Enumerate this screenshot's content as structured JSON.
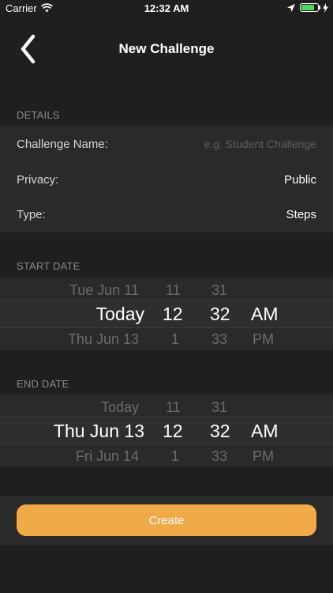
{
  "status_bar": {
    "carrier": "Carrier",
    "time": "12:32 AM",
    "battery_level": 0.8
  },
  "nav": {
    "title": "New Challenge"
  },
  "details": {
    "header": "DETAILS",
    "challenge_name_label": "Challenge Name:",
    "challenge_name_placeholder": "e.g. Student Challenge",
    "privacy_label": "Privacy:",
    "privacy_value": "Public",
    "type_label": "Type:",
    "type_value": "Steps"
  },
  "start_date": {
    "header": "START DATE",
    "prev": {
      "date": "Tue Jun 11",
      "hour": "11",
      "minute": "31",
      "ampm": ""
    },
    "selected": {
      "date": "Today",
      "hour": "12",
      "minute": "32",
      "ampm": "AM"
    },
    "next": {
      "date": "Thu Jun 13",
      "hour": "1",
      "minute": "33",
      "ampm": "PM"
    }
  },
  "end_date": {
    "header": "END DATE",
    "prev": {
      "date": "Today",
      "hour": "11",
      "minute": "31",
      "ampm": ""
    },
    "selected": {
      "date": "Thu Jun 13",
      "hour": "12",
      "minute": "32",
      "ampm": "AM"
    },
    "next": {
      "date": "Fri Jun 14",
      "hour": "1",
      "minute": "33",
      "ampm": "PM"
    }
  },
  "create_label": "Create",
  "colors": {
    "accent": "#f0ab48",
    "background": "#1f1f1f",
    "cell": "#2a2a2a"
  }
}
